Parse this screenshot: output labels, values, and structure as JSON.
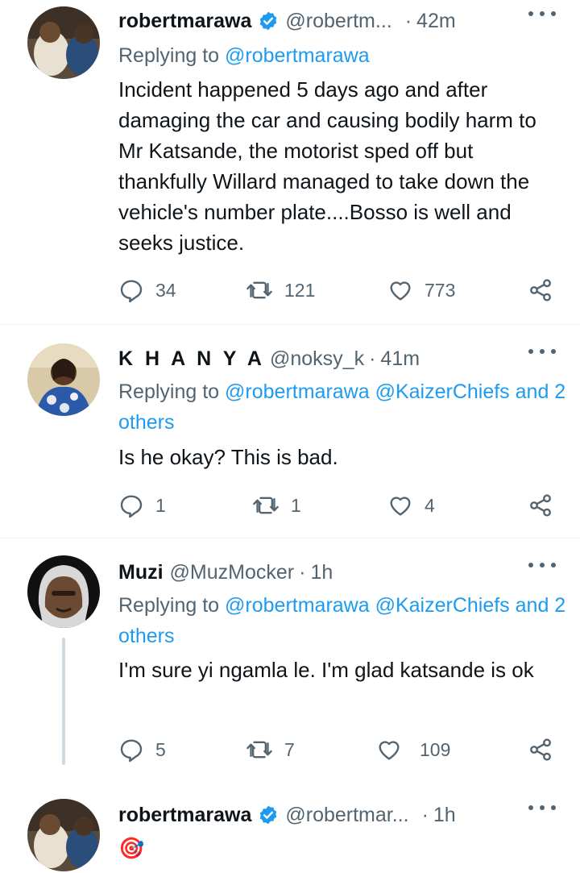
{
  "tweets": [
    {
      "name": "robertmarawa",
      "handle": "@robertm...",
      "dot": "·",
      "time": "42m",
      "verified": true,
      "replying_label": "Replying to",
      "replying_link": "@robertmarawa",
      "replying_rest": "",
      "body": "Incident happened 5 days ago and after damaging the car and causing bodily harm to Mr Katsande, the motorist sped off but thankfully Willard managed to take down the vehicle's number plate....Bosso is well and seeks justice.",
      "replies": "34",
      "retweets": "121",
      "likes": "773"
    },
    {
      "name": "K H A N Y A",
      "handle": "@noksy_k",
      "dot": "·",
      "time": "41m",
      "verified": false,
      "replying_label": "Replying to",
      "replying_link": "@robertmarawa @KaizerChiefs",
      "replying_rest": "and 2 others",
      "body": "Is he okay? This is bad.",
      "replies": "1",
      "retweets": "1",
      "likes": "4"
    },
    {
      "name": "Muzi",
      "handle": "@MuzMocker",
      "dot": "·",
      "time": "1h",
      "verified": false,
      "replying_label": "Replying to",
      "replying_link": "@robertmarawa @KaizerChiefs",
      "replying_rest": "and 2 others",
      "body": "I'm sure yi ngamla le. I'm glad katsande is ok",
      "replies": "5",
      "retweets": "7",
      "likes": "109"
    },
    {
      "name": "robertmarawa",
      "handle": "@robertmar...",
      "dot": "·",
      "time": "1h",
      "verified": true,
      "body": "🎯"
    }
  ],
  "colors": {
    "accent": "#1d9bf0",
    "secondary_text": "#536471",
    "divider": "#eff3f4"
  },
  "icons": [
    "verified-badge-icon",
    "more-options-icon",
    "reply-icon",
    "retweet-icon",
    "like-icon",
    "share-icon"
  ]
}
